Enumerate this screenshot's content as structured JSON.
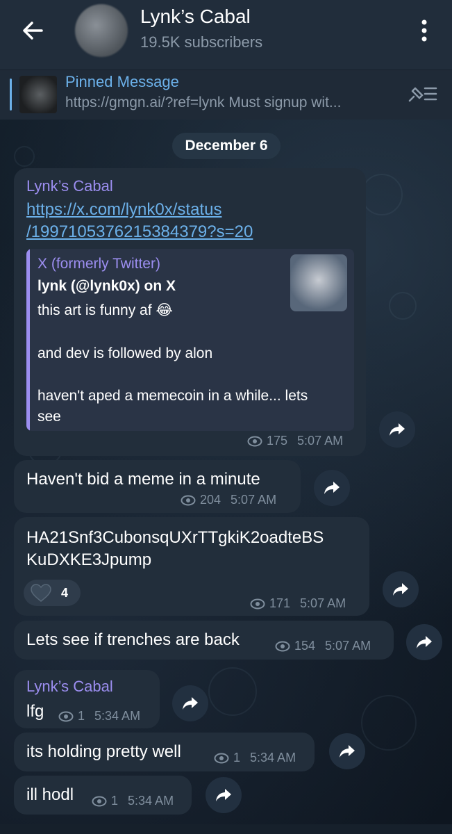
{
  "header": {
    "title": "Lynk’s Cabal",
    "subtitle": "19.5K subscribers"
  },
  "pinned": {
    "title": "Pinned Message",
    "text": "https://gmgn.ai/?ref=lynk  Must signup wit..."
  },
  "date_chip": "December 6",
  "messages": [
    {
      "sender": "Lynk’s Cabal",
      "link_line1": "https://x.com/lynk0x/status",
      "link_line2": "/1997105376215384379?s=20",
      "preview": {
        "site": "X (formerly Twitter)",
        "title": "lynk (@lynk0x) on X",
        "line1": "this art is funny af 😂",
        "line2": "and dev is followed by alon",
        "line3": "haven't aped a memecoin in a while... lets",
        "line4": "see"
      },
      "views": "175",
      "time": "5:07 AM"
    },
    {
      "text": "Haven't bid a meme in a minute",
      "views": "204",
      "time": "5:07 AM"
    },
    {
      "text_line1": "HA21Snf3CubonsqUXrTTgkiK2oadteBS",
      "text_line2": "KuDXKE3Jpump",
      "reaction_count": "4",
      "views": "171",
      "time": "5:07 AM"
    },
    {
      "text": "Lets see if trenches are back",
      "views": "154",
      "time": "5:07 AM"
    },
    {
      "sender": "Lynk’s Cabal",
      "text": "lfg",
      "views": "1",
      "time": "5:34 AM"
    },
    {
      "text": "its holding pretty well",
      "views": "1",
      "time": "5:34 AM"
    },
    {
      "text": "ill hodl",
      "views": "1",
      "time": "5:34 AM"
    }
  ],
  "colors": {
    "accent": "#6cb1ea",
    "sender": "#9c8ef0",
    "bubble": "#222e3b",
    "header": "#212d3b",
    "meta": "#7f8e9d"
  },
  "icons": [
    "back-arrow-icon",
    "more-vertical-icon",
    "pin-list-icon",
    "eye-icon",
    "share-icon",
    "heart-icon"
  ]
}
